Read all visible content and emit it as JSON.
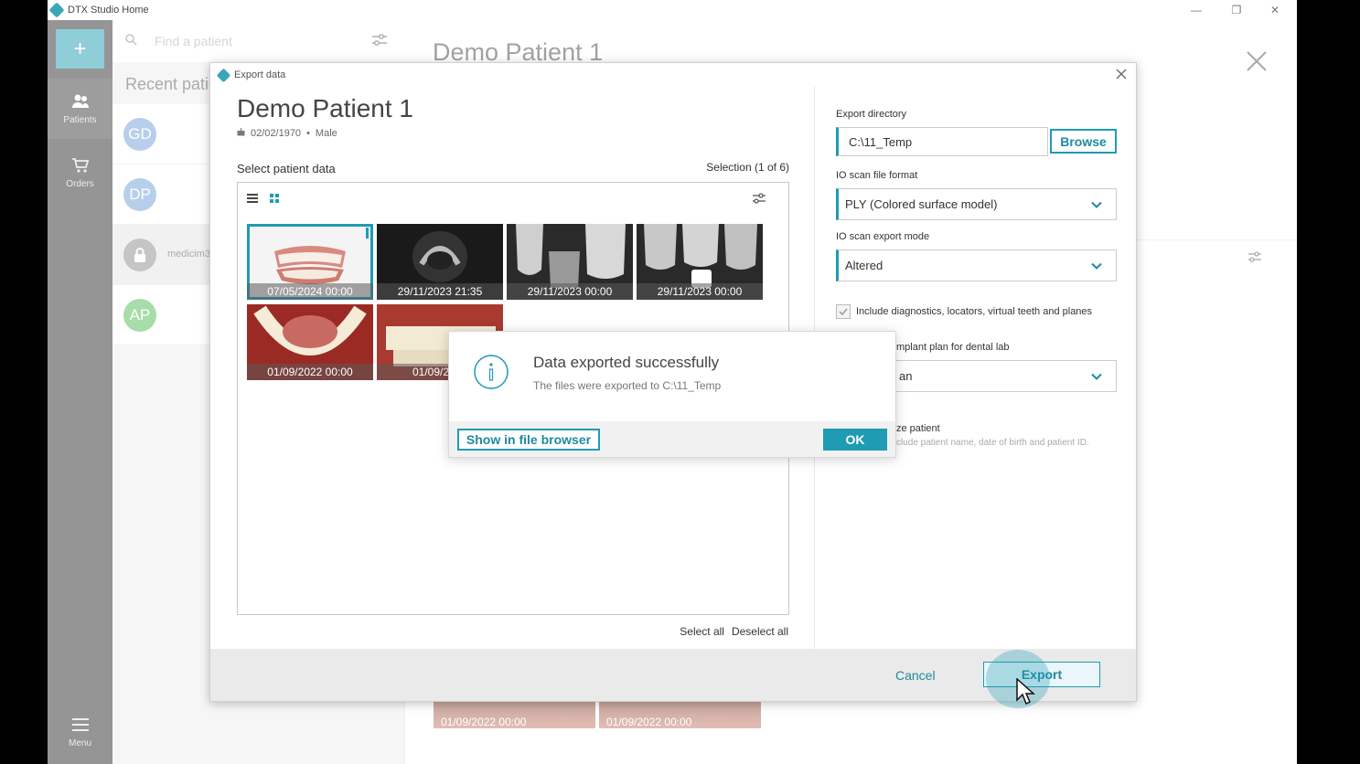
{
  "app": {
    "title": "DTX Studio Home",
    "nav": {
      "add": "+",
      "patients": "Patients",
      "orders": "Orders",
      "menu": "Menu"
    },
    "search": {
      "placeholder": "Find a patient"
    },
    "recent_label": "Recent patie",
    "patients": [
      {
        "initials": "GD",
        "color": "#6f9fd6"
      },
      {
        "initials": "DP",
        "color": "#6f9fd6"
      },
      {
        "initials": "",
        "name": "medicim3",
        "color": "#8a8a8a"
      },
      {
        "initials": "AP",
        "color": "#4dbb52"
      }
    ],
    "bg_title": "Demo Patient 1",
    "bg_thumbs": [
      "01/09/2022 00:00",
      "01/09/2022 00:00"
    ]
  },
  "dialog": {
    "title": "Export data",
    "patient_name": "Demo Patient 1",
    "dob": "02/02/1970",
    "bullet": "•",
    "gender": "Male",
    "select_label": "Select patient data",
    "selection_count": "Selection (1 of 6)",
    "thumbs": [
      {
        "caption": "07/05/2024 00:00"
      },
      {
        "caption": "29/11/2023 21:35"
      },
      {
        "caption": "29/11/2023 00:00"
      },
      {
        "caption": "29/11/2023 00:00"
      },
      {
        "caption": "01/09/2022 00:00"
      },
      {
        "caption": "01/09/2022"
      }
    ],
    "select_all": "Select all",
    "deselect_all": "Deselect all",
    "export_dir_label": "Export directory",
    "export_dir_value": "C:\\11_Temp",
    "browse": "Browse",
    "io_format_label": "IO scan file format",
    "io_format_value": "PLY (Colored surface model)",
    "io_mode_label": "IO scan export mode",
    "io_mode_value": "Altered",
    "include_label": "Include diagnostics, locators, virtual teeth and planes",
    "implant_label": "mplant plan for dental lab",
    "implant_value": "an",
    "anon_label": "ze patient",
    "anon_hint": "clude patient name, date of birth and patient ID.",
    "cancel": "Cancel",
    "export": "Export"
  },
  "message": {
    "title": "Data exported successfully",
    "subtitle": "The files were exported to C:\\11_Temp",
    "show_in_browser": "Show in file browser",
    "ok": "OK"
  },
  "colors": {
    "accent": "#1f9bb3",
    "nav_bg": "#2b2b2b"
  }
}
